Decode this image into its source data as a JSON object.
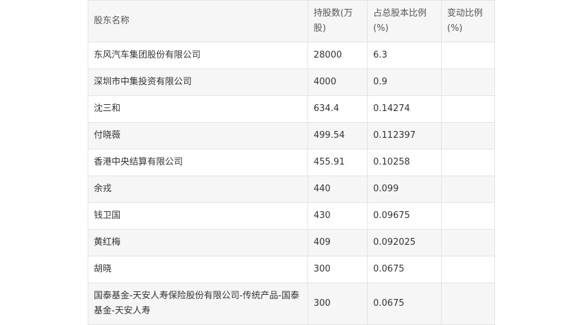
{
  "table": {
    "headers": [
      "股东名称",
      "持股数(万股)",
      "占总股本比例(%)",
      "变动比例(%)"
    ],
    "rows": [
      {
        "name": "东风汽车集团股份有限公司",
        "shares": "28000",
        "ratio": "6.3",
        "change": ""
      },
      {
        "name": "深圳市中集投资有限公司",
        "shares": "4000",
        "ratio": "0.9",
        "change": ""
      },
      {
        "name": "沈三和",
        "shares": "634.4",
        "ratio": "0.14274",
        "change": ""
      },
      {
        "name": "付晓薇",
        "shares": "499.54",
        "ratio": "0.112397",
        "change": ""
      },
      {
        "name": "香港中央结算有限公司",
        "shares": "455.91",
        "ratio": "0.10258",
        "change": ""
      },
      {
        "name": "余戎",
        "shares": "440",
        "ratio": "0.099",
        "change": ""
      },
      {
        "name": "钱卫国",
        "shares": "430",
        "ratio": "0.09675",
        "change": ""
      },
      {
        "name": "黄红梅",
        "shares": "409",
        "ratio": "0.092025",
        "change": ""
      },
      {
        "name": "胡晓",
        "shares": "300",
        "ratio": "0.0675",
        "change": ""
      },
      {
        "name": "国泰基金-天安人寿保险股份有限公司-传统产品-国泰基金-天安人寿",
        "shares": "300",
        "ratio": "0.0675",
        "change": ""
      }
    ]
  }
}
